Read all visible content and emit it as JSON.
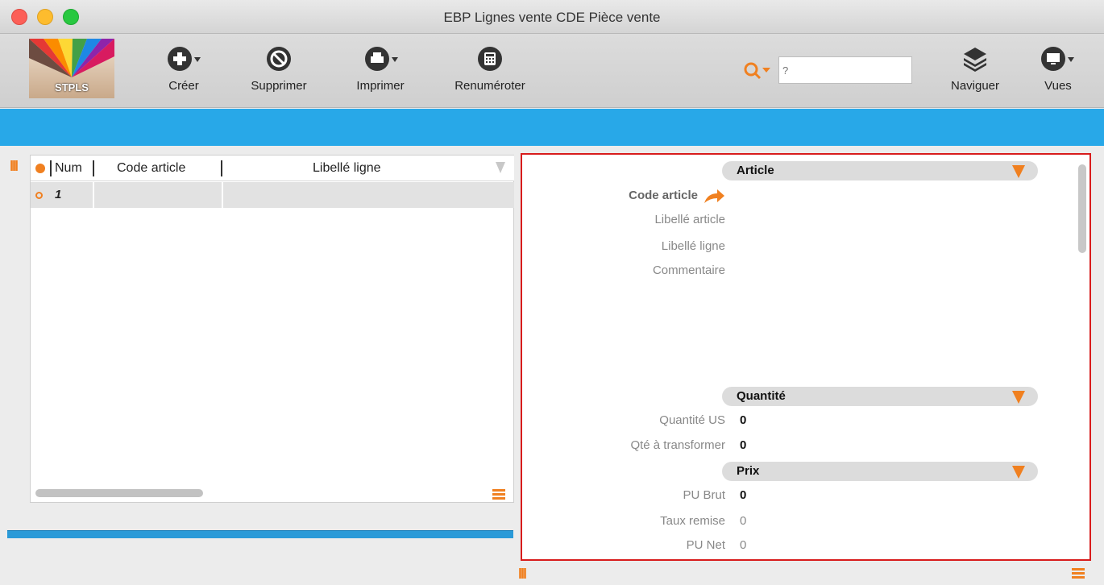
{
  "window": {
    "title": "EBP Lignes vente CDE Pièce vente"
  },
  "logo": {
    "text": "STPLS"
  },
  "toolbar": {
    "creer": "Créer",
    "supprimer": "Supprimer",
    "imprimer": "Imprimer",
    "renumeroter": "Renuméroter",
    "naviguer": "Naviguer",
    "vues": "Vues"
  },
  "search": {
    "placeholder": "?"
  },
  "grid": {
    "columns": [
      "Num",
      "Code article",
      "Libellé ligne"
    ],
    "rows": [
      {
        "num": "1",
        "code": "",
        "libelle": ""
      }
    ]
  },
  "detail": {
    "sections": {
      "article": "Article",
      "quantite": "Quantité",
      "prix": "Prix"
    },
    "fields": {
      "code_article": "Code article",
      "libelle_article": "Libellé article",
      "libelle_ligne": "Libellé ligne",
      "commentaire": "Commentaire",
      "quantite_us": "Quantité US",
      "quantite_us_val": "0",
      "qte_transformer": "Qté à transformer",
      "qte_transformer_val": "0",
      "pu_brut": "PU Brut",
      "pu_brut_val": "0",
      "taux_remise": "Taux remise",
      "taux_remise_val": "0",
      "pu_net": "PU Net",
      "pu_net_val": "0"
    }
  },
  "colors": {
    "accent": "#f08020",
    "band": "#28a8e8",
    "highlight_border": "#d81c1c"
  }
}
